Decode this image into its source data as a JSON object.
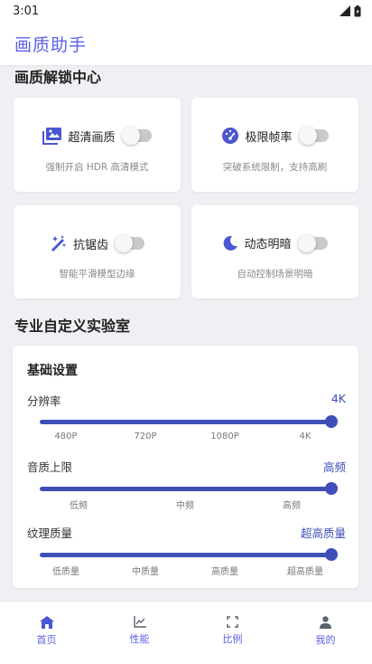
{
  "status": {
    "time": "3:01"
  },
  "app": {
    "title": "画质助手"
  },
  "unlock": {
    "title": "画质解锁中心",
    "cards": [
      {
        "label": "超清画质",
        "desc": "强制开启 HDR 高清模式",
        "icon": "photo-icon",
        "enabled": false
      },
      {
        "label": "极限帧率",
        "desc": "突破系统限制，支持高刷",
        "icon": "speedometer-icon",
        "enabled": false
      },
      {
        "label": "抗锯齿",
        "desc": "智能平滑模型边缘",
        "icon": "magic-wand-icon",
        "enabled": false
      },
      {
        "label": "动态明暗",
        "desc": "自动控制场景明暗",
        "icon": "moon-icon",
        "enabled": false
      }
    ]
  },
  "lab": {
    "title": "专业自定义实验室",
    "card_title": "基础设置",
    "settings": [
      {
        "label": "分辨率",
        "value": "4K",
        "ticks": [
          "480P",
          "720P",
          "1080P",
          "4K"
        ],
        "level": 1.0
      },
      {
        "label": "音质上限",
        "value": "高频",
        "ticks": [
          "低频",
          "中频",
          "高频"
        ],
        "level": 1.0
      },
      {
        "label": "纹理质量",
        "value": "超高质量",
        "ticks": [
          "低质量",
          "中质量",
          "高质量",
          "超高质量"
        ],
        "level": 1.0
      }
    ]
  },
  "nav": {
    "items": [
      {
        "label": "首页",
        "icon": "home-icon",
        "active": true
      },
      {
        "label": "性能",
        "icon": "chart-icon",
        "active": false
      },
      {
        "label": "比例",
        "icon": "fullscreen-icon",
        "active": false
      },
      {
        "label": "我的",
        "icon": "person-icon",
        "active": false
      }
    ]
  },
  "colors": {
    "accent": "#5b60e6",
    "slider": "#3f4fb8",
    "background": "#eef0f3"
  }
}
